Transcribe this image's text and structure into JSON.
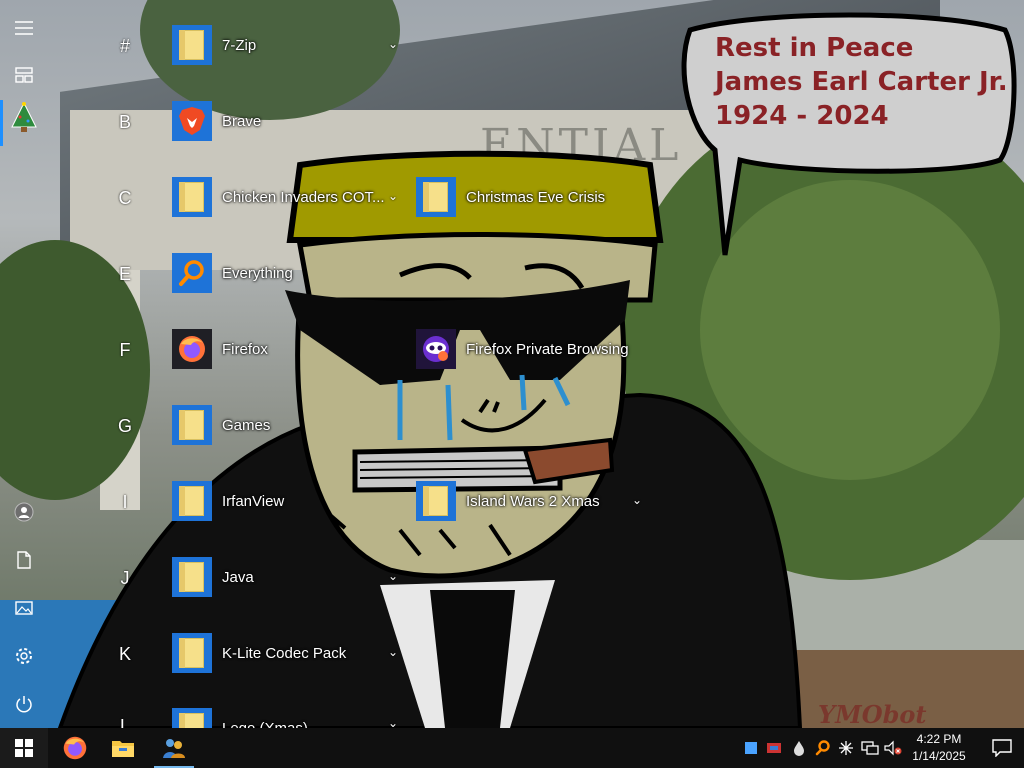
{
  "speech_bubble": {
    "line1": "Rest in Peace",
    "line2": "James Earl Carter Jr.",
    "line3": "1924 - 2024"
  },
  "building_sign": "ENTIAL",
  "watermark": "YMObot",
  "rail": {
    "items": [
      {
        "icon": "hamburger-icon"
      },
      {
        "icon": "tiles-icon"
      },
      {
        "icon": "christmas-tree-icon"
      },
      {
        "icon": "user-avatar-icon"
      },
      {
        "icon": "documents-icon"
      },
      {
        "icon": "pictures-icon"
      },
      {
        "icon": "settings-gear-icon"
      },
      {
        "icon": "power-icon"
      }
    ]
  },
  "start_menu": {
    "groups": [
      {
        "letter": "#"
      },
      {
        "letter": "B"
      },
      {
        "letter": "C"
      },
      {
        "letter": "E"
      },
      {
        "letter": "F"
      },
      {
        "letter": "G"
      },
      {
        "letter": "I"
      },
      {
        "letter": "J"
      },
      {
        "letter": "K"
      },
      {
        "letter": "L"
      }
    ],
    "apps": [
      {
        "label": "7-Zip",
        "icon": "folder-icon",
        "expandable": true
      },
      {
        "label": "Brave",
        "icon": "brave-icon",
        "expandable": false
      },
      {
        "label": "Chicken Invaders COT...",
        "icon": "folder-icon",
        "expandable": true
      },
      {
        "label": "Christmas Eve Crisis",
        "icon": "folder-icon",
        "expandable": false
      },
      {
        "label": "Everything",
        "icon": "search-magnifier-icon",
        "expandable": false
      },
      {
        "label": "Firefox",
        "icon": "firefox-icon",
        "expandable": false
      },
      {
        "label": "Firefox Private Browsing",
        "icon": "firefox-private-icon",
        "expandable": false
      },
      {
        "label": "Games",
        "icon": "folder-icon",
        "expandable": false
      },
      {
        "label": "IrfanView",
        "icon": "folder-icon",
        "expandable": false
      },
      {
        "label": "Island Wars 2 Xmas",
        "icon": "folder-icon",
        "expandable": true
      },
      {
        "label": "Java",
        "icon": "folder-icon",
        "expandable": true
      },
      {
        "label": "K-Lite Codec Pack",
        "icon": "folder-icon",
        "expandable": true
      },
      {
        "label": "Lego (Xmas)",
        "icon": "folder-icon",
        "expandable": true
      }
    ]
  },
  "taskbar": {
    "apps": [
      {
        "icon": "windows-start-icon"
      },
      {
        "icon": "firefox-icon"
      },
      {
        "icon": "file-explorer-icon"
      },
      {
        "icon": "people-app-icon"
      }
    ],
    "tray": [
      {
        "icon": "blue-square-icon"
      },
      {
        "icon": "tray-app-icon"
      },
      {
        "icon": "droplet-icon"
      },
      {
        "icon": "everything-search-icon"
      },
      {
        "icon": "sparkle-icon"
      },
      {
        "icon": "network-icon"
      },
      {
        "icon": "volume-muted-icon"
      }
    ],
    "time": "4:22 PM",
    "date": "1/14/2025"
  }
}
